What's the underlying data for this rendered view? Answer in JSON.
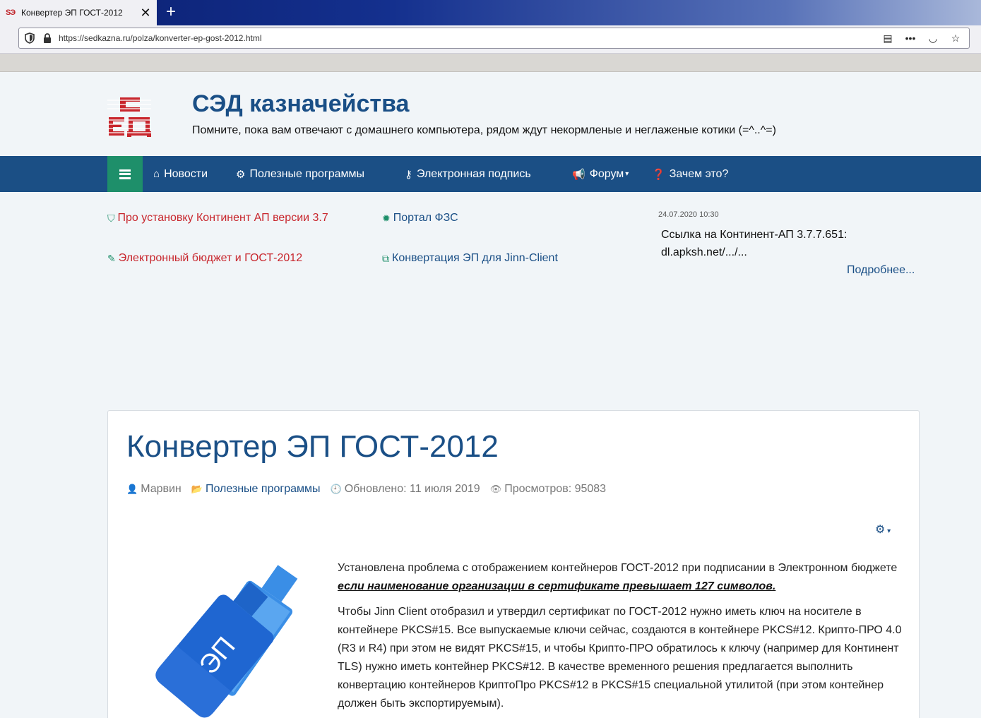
{
  "browser": {
    "tab_title": "Конвертер ЭП ГОСТ-2012",
    "url": "https://sedkazna.ru/polza/konverter-ep-gost-2012.html"
  },
  "site": {
    "title": "СЭД казначейства",
    "tagline": "Помните, пока вам отвечают с домашнего компьютера, рядом ждут некормленые и неглаженые котики (=^..^=)"
  },
  "nav": {
    "items": [
      {
        "label": "Новости",
        "icon": "home-icon"
      },
      {
        "label": "Полезные программы",
        "icon": "cogs-icon"
      },
      {
        "label": "Электронная подпись",
        "icon": "key-icon"
      },
      {
        "label": "Форум",
        "icon": "bullhorn-icon"
      },
      {
        "label": "Зачем это?",
        "icon": "question-circle-icon"
      }
    ]
  },
  "quick_links": {
    "kontinent": "Про установку Континент АП версии 3.7",
    "budget": "Электронный бюджет и ГОСТ-2012",
    "fzs": "Портал ФЗС",
    "jinn": "Конвертация ЭП для Jinn-Client"
  },
  "news": {
    "date": "24.07.2020 10:30",
    "text": "Ссылка на Континент-АП 3.7.7.651: dl.apksh.net/.../...",
    "more": "Подробнее..."
  },
  "article": {
    "title": "Конвертер ЭП ГОСТ-2012",
    "author": "Марвин",
    "category": "Полезные программы",
    "updated": "Обновлено: 11 июля 2019",
    "views": "Просмотров: 95083",
    "p1_text": "Установлена проблема с отображением контейнеров ГОСТ-2012 при подписании в Электронном бюджете ",
    "p1_em": "если наименование организации в сертификате превышает 127 символов.",
    "p2": "Чтобы Jinn Client отобразил и утвердил сертификат по ГОСТ-2012 нужно иметь ключ на носителе в контейнере PKCS#15. Все выпускаемые ключи сейчас, создаются в контейнере PKCS#12. Крипто-ПРО 4.0 (R3 и R4) при этом не видят PKCS#15, и чтобы Крипто-ПРО обратилось к ключу (например для Континент TLS) нужно иметь контейнер PKCS#12. В качестве временного решения предлагается выполнить конвертацию контейнеров КриптоПро PKCS#12 в PKCS#15 специальной утилитой (при этом контейнер должен быть экспортируемым).",
    "usb_label": "ЭП"
  },
  "colors": {
    "nav_bg": "#1b4f85",
    "hamburger_bg": "#1e8f6a",
    "title_blue": "#1a4f86",
    "link_red": "#c8262d"
  }
}
